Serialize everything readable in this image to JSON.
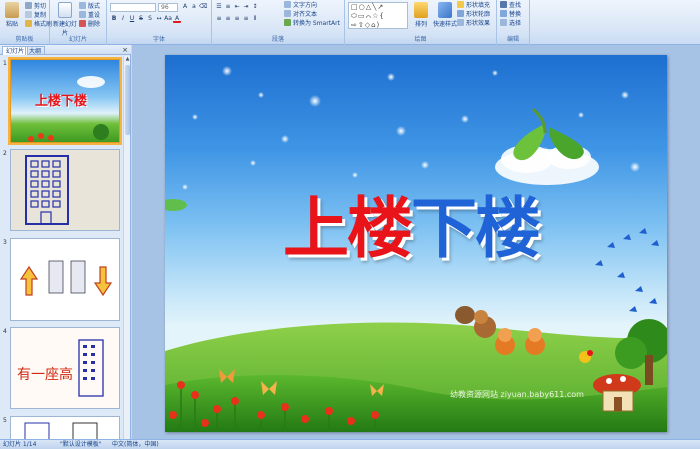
{
  "ribbon": {
    "clipboard": {
      "label": "剪贴板",
      "paste": "粘贴",
      "cut": "剪切",
      "copy": "复制",
      "format_painter": "格式刷"
    },
    "slides": {
      "label": "幻灯片",
      "new_slide": "新建幻灯片",
      "layout": "版式",
      "reset": "重设",
      "delete": "删除"
    },
    "font": {
      "label": "字体",
      "font_name": "",
      "font_size": "96"
    },
    "paragraph": {
      "label": "段落",
      "text_direction": "文字方向",
      "align_text": "对齐文本",
      "smartart": "转换为 SmartArt"
    },
    "drawing": {
      "label": "绘图",
      "arrange": "排列",
      "quick_styles": "快速样式",
      "shape_fill": "形状填充",
      "shape_outline": "形状轮廓",
      "shape_effects": "形状效果"
    },
    "editing": {
      "label": "编辑",
      "find": "查找",
      "replace": "替换",
      "select": "选择"
    }
  },
  "pane": {
    "tab_slides": "幻灯片",
    "tab_outline": "大纲",
    "close": "×",
    "thumbnails": [
      {
        "num": "1",
        "caption": "上楼下楼"
      },
      {
        "num": "2",
        "caption": ""
      },
      {
        "num": "3",
        "caption": ""
      },
      {
        "num": "4",
        "caption": "有一座高"
      },
      {
        "num": "5",
        "caption": ""
      }
    ]
  },
  "slide": {
    "title_part1": "上楼",
    "title_part2": "下楼",
    "watermark": "幼教资源网站 ziyuan.baby611.com"
  },
  "statusbar": {
    "slide_info": "幻灯片 1/14",
    "theme": "\"默认设计模板\"",
    "language": "中文(简体，中国)"
  },
  "colors": {
    "title_red": "#e8141a",
    "title_blue": "#1f63d6",
    "ribbon_bg": "#dce8f7",
    "selection_outline": "#f5b342"
  }
}
